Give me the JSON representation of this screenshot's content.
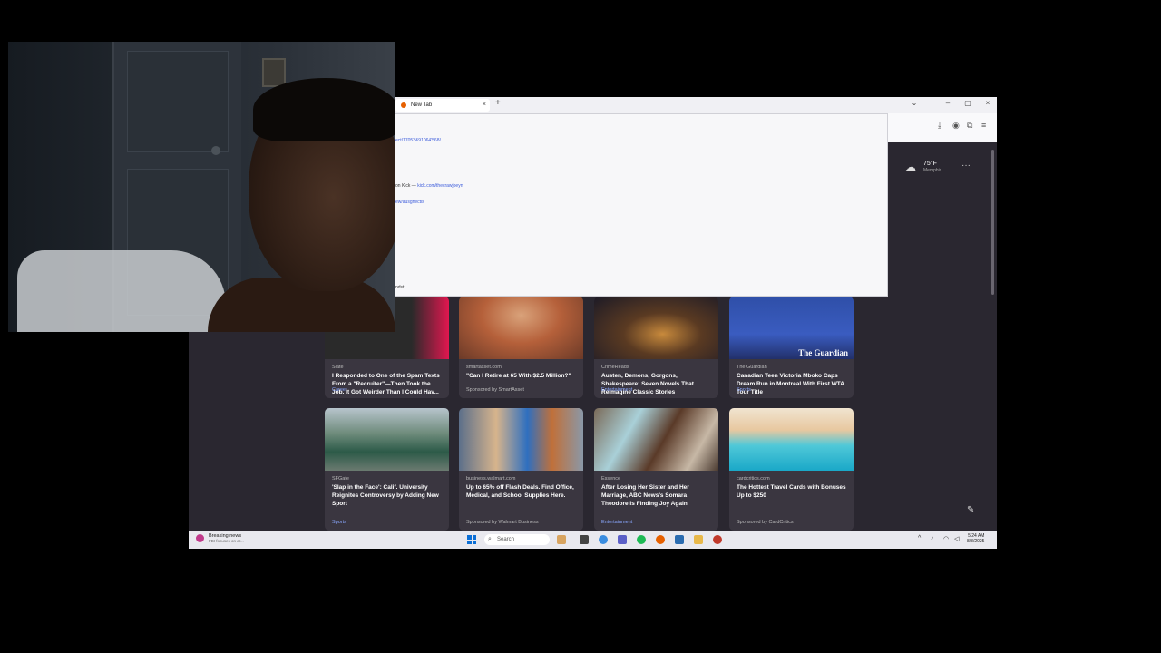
{
  "browser": {
    "tab_title": "New Tab",
    "new_tab_symbol": "+",
    "close_symbol": "×",
    "window_controls": {
      "dropdown": "⌄",
      "minimize": "–",
      "maximize": "▢",
      "close": "×"
    }
  },
  "popup": {
    "line1": "ect/17053&91064'568/",
    "line2_label": "on Kick",
    "line2_sep": "—",
    "line2_link": "kick.com/thecrawjoeyn",
    "line3": "ew/ausgnectis",
    "line4": "ndst"
  },
  "weather": {
    "icon": "cloud-icon",
    "temp": "75°F",
    "city": "Memphis"
  },
  "more_symbol": "···",
  "cards_row1": [
    {
      "source": "Slate",
      "title": "I Responded to One of the Spam Texts From a \"Recruiter\"—Then Took the Job. It Got Weirder Than I Could Hav...",
      "category": "Career",
      "sponsored": false
    },
    {
      "source": "smartasset.com",
      "title": "\"Can I Retire at 65 With $2.5 Million?\"",
      "category": "Sponsored by SmartAsset",
      "sponsored": true
    },
    {
      "source": "CrimeReads",
      "title": "Austen, Demons, Gorgons, Shakespeare: Seven Novels That Reimagine Classic Stories",
      "category": "Entertainment",
      "sponsored": false
    },
    {
      "source": "The Guardian",
      "title": "Canadian Teen Victoria Mboko Caps Dream Run in Montreal With First WTA Tour Title",
      "category": "Sports",
      "sponsored": false,
      "overlay": "The Guardian"
    }
  ],
  "cards_row2": [
    {
      "source": "SFGate",
      "title": "'Slap in the Face': Calif. University Reignites Controversy by Adding New Sport",
      "category": "Sports",
      "sponsored": false
    },
    {
      "source": "business.walmart.com",
      "title": "Up to 65% off Flash Deals. Find Office, Medical, and School Supplies Here.",
      "category": "Sponsored by Walmart Business",
      "sponsored": true
    },
    {
      "source": "Essence",
      "title": "After Losing Her Sister and Her Marriage, ABC News's Somara Theodore Is Finding Joy Again",
      "category": "Entertainment",
      "sponsored": false
    },
    {
      "source": "cardcritics.com",
      "title": "The Hottest Travel Cards with Bonuses Up to $250",
      "category": "Sponsored by CardCritics",
      "sponsored": true
    }
  ],
  "taskbar": {
    "news_title": "Breaking news",
    "news_sub": "FBI focuses on dr...",
    "search_placeholder": "Search",
    "time": "5:24 AM",
    "date": "8/8/2025"
  }
}
